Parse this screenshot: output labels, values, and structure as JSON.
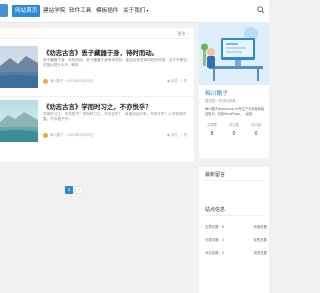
{
  "nav": {
    "items": [
      {
        "label": "网站首页",
        "active": true
      },
      {
        "label": "建站学院",
        "active": false
      },
      {
        "label": "软件工具",
        "active": false
      },
      {
        "label": "模板插件",
        "active": false
      },
      {
        "label": "关于我们",
        "active": false
      }
    ],
    "dropdown_caret": "▾",
    "search_icon": "search-icon"
  },
  "list": {
    "more_label": "更多 ›"
  },
  "posts": [
    {
      "title": "《劝志古言》丢子藏器于身，待时而动。",
      "excerpt": "丢子藏器于身，待时而动。丢子藏器于身等待时机，能否出来发挥时机的时候，这才不是说...可能出现什么不...等其...",
      "author": "梅川酷子",
      "date": "2024年05月28日",
      "views": "浏览",
      "likes": "赞"
    },
    {
      "title": "《劝志古言》学而时习之，不亦悦乎？",
      "excerpt": "学而时习之，不亦悦乎？学而时习之，不亦说乎？...有朋自远方来，不亦乐乎？人不知而不愠，不亦君子乎...",
      "author": "梅川酷子",
      "date": "2024年05月28日",
      "views": "浏览",
      "likes": "赞"
    }
  ],
  "pager": {
    "current": "1",
    "next": "›"
  },
  "profile": {
    "name": "梅川酷子",
    "subtitle": "建站是一件快乐的事",
    "desc": "梅川酷子(www.mcrk.cn)专注于分享各种建站知识，包括WordPress、...运营...",
    "stats": [
      {
        "label": "文章数",
        "value": "8"
      },
      {
        "label": "评论数",
        "value": "0"
      },
      {
        "label": "访问量",
        "value": "0"
      }
    ]
  },
  "recent_comments": {
    "title": "最新留言"
  },
  "site_info": {
    "title": "站点信息",
    "rows": [
      {
        "label": "文章总数：8",
        "right": "页面总数"
      },
      {
        "label": "分类总数：3",
        "right": "标签总数"
      },
      {
        "label": "评论总数：0",
        "right": "浏览总数"
      }
    ]
  },
  "colors": {
    "accent": "#2f88d4",
    "background": "#f1f1f1"
  }
}
